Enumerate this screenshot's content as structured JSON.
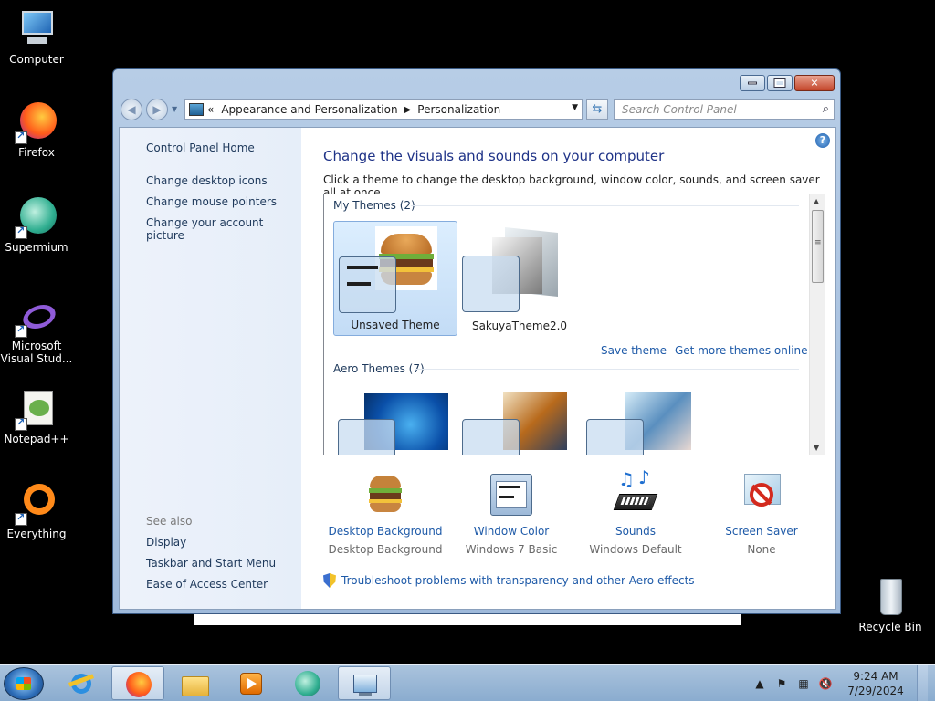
{
  "desktop": {
    "icons": [
      {
        "label": "Computer"
      },
      {
        "label": "Firefox"
      },
      {
        "label": "Supermium"
      },
      {
        "label": "Microsoft Visual Stud..."
      },
      {
        "label": "Notepad++"
      },
      {
        "label": "Everything"
      },
      {
        "label": "Recycle Bin"
      }
    ]
  },
  "window": {
    "address": {
      "overflow_glyph": "«",
      "crumbs": [
        "Appearance and Personalization",
        "Personalization"
      ],
      "separator": "▶"
    },
    "search_placeholder": "Search Control Panel",
    "left_pane": {
      "home": "Control Panel Home",
      "links": [
        "Change desktop icons",
        "Change mouse pointers",
        "Change your account picture"
      ],
      "see_also_title": "See also",
      "see_also": [
        "Display",
        "Taskbar and Start Menu",
        "Ease of Access Center"
      ]
    },
    "heading": "Change the visuals and sounds on your computer",
    "subheading": "Click a theme to change the desktop background, window color, sounds, and screen saver all at once.",
    "my_themes": {
      "group_label": "My Themes (2)",
      "items": [
        {
          "label": "Unsaved Theme",
          "selected": true
        },
        {
          "label": "SakuyaTheme2.0",
          "selected": false
        }
      ],
      "save_link": "Save theme",
      "more_link": "Get more themes online"
    },
    "aero_themes": {
      "group_label": "Aero Themes (7)"
    },
    "bottom": [
      {
        "title": "Desktop Background",
        "value": "Desktop Background",
        "icon": "burger-icon"
      },
      {
        "title": "Window Color",
        "value": "Windows 7 Basic",
        "icon": "window-color-icon"
      },
      {
        "title": "Sounds",
        "value": "Windows Default",
        "icon": "music-notes-icon"
      },
      {
        "title": "Screen Saver",
        "value": "None",
        "icon": "no-screensaver-icon"
      }
    ],
    "troubleshoot": "Troubleshoot problems with transparency and other Aero effects"
  },
  "taskbar": {
    "clock_time": "9:24 AM",
    "clock_date": "7/29/2024"
  }
}
